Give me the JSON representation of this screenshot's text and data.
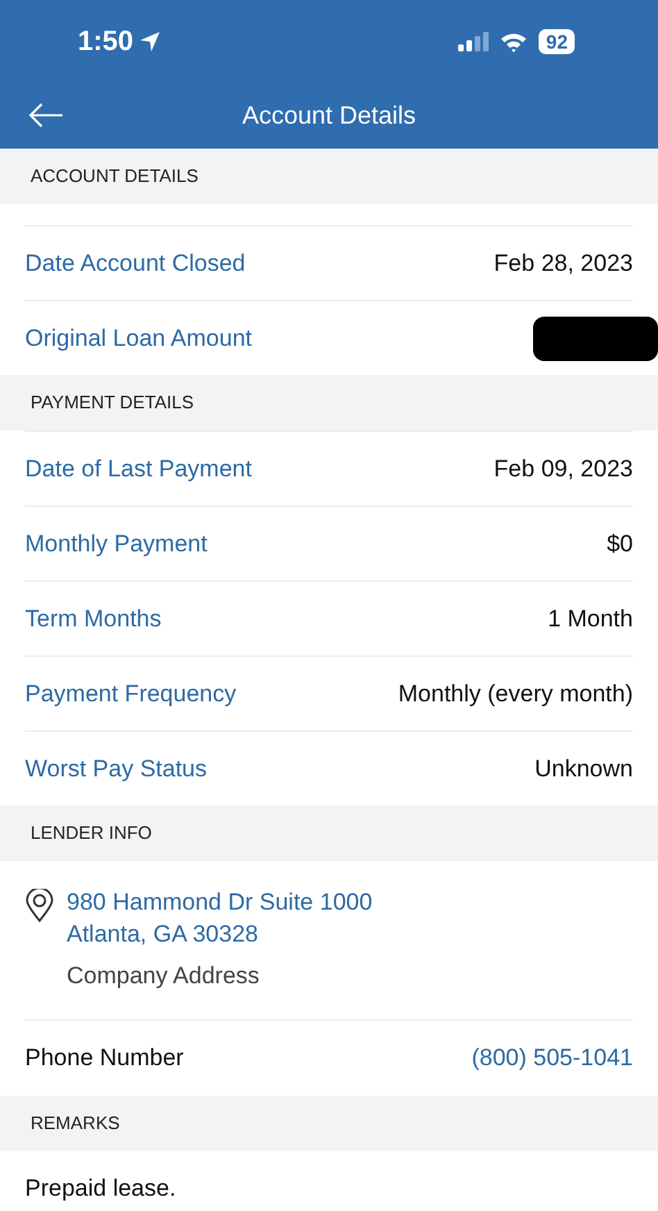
{
  "status_bar": {
    "time": "1:50",
    "battery": "92"
  },
  "nav": {
    "title": "Account Details"
  },
  "sections": [
    {
      "kind": "rows",
      "header": "ACCOUNT DETAILS",
      "gap_top": true,
      "rows": [
        {
          "label": "Date Account Closed",
          "value": "Feb 28, 2023",
          "redacted": false
        },
        {
          "label": "Original Loan Amount",
          "redacted": true
        }
      ]
    },
    {
      "kind": "rows",
      "header": "PAYMENT DETAILS",
      "gap_top": false,
      "rows": [
        {
          "label": "Date of Last Payment",
          "value": "Feb 09, 2023",
          "redacted": false
        },
        {
          "label": "Monthly Payment",
          "value": "$0",
          "redacted": false
        },
        {
          "label": "Term Months",
          "value": "1 Month",
          "redacted": false
        },
        {
          "label": "Payment Frequency",
          "value": "Monthly (every month)",
          "redacted": false
        },
        {
          "label": "Worst Pay Status",
          "value": "Unknown",
          "redacted": false
        }
      ]
    },
    {
      "kind": "lender",
      "header": "LENDER INFO",
      "address": [
        "980 Hammond Dr Suite 1000",
        "Atlanta, GA 30328"
      ],
      "address_label": "Company Address",
      "phone_label": "Phone Number",
      "phone": "(800) 505-1041"
    },
    {
      "kind": "remarks",
      "header": "REMARKS",
      "text": "Prepaid lease."
    }
  ]
}
